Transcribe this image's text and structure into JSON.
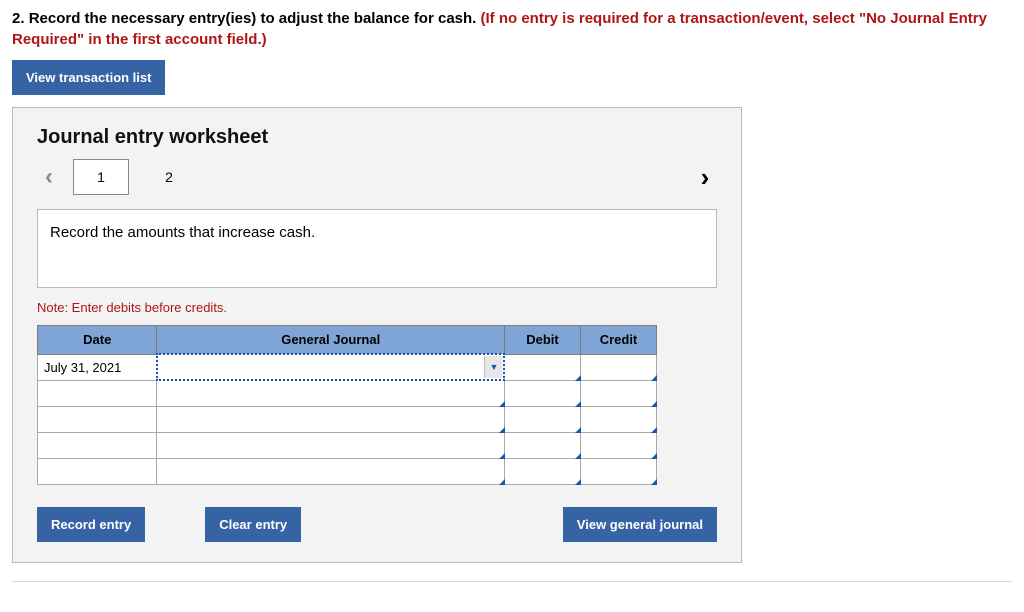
{
  "question": {
    "prefix": "2. ",
    "text": "Record the necessary entry(ies) to adjust the balance for cash. ",
    "red": "(If no entry is required for a transaction/event, select \"No Journal Entry Required\" in the first account field.)"
  },
  "buttons": {
    "view_transaction_list": "View transaction list",
    "record_entry": "Record entry",
    "clear_entry": "Clear entry",
    "view_general_journal": "View general journal"
  },
  "worksheet": {
    "title": "Journal entry worksheet",
    "tabs": [
      "1",
      "2"
    ],
    "active_tab": 0,
    "instruction": "Record the amounts that increase cash.",
    "note": "Note: Enter debits before credits.",
    "headers": {
      "date": "Date",
      "general_journal": "General Journal",
      "debit": "Debit",
      "credit": "Credit"
    },
    "rows": [
      {
        "date": "July 31, 2021",
        "gj": "",
        "debit": "",
        "credit": ""
      },
      {
        "date": "",
        "gj": "",
        "debit": "",
        "credit": ""
      },
      {
        "date": "",
        "gj": "",
        "debit": "",
        "credit": ""
      },
      {
        "date": "",
        "gj": "",
        "debit": "",
        "credit": ""
      },
      {
        "date": "",
        "gj": "",
        "debit": "",
        "credit": ""
      }
    ]
  }
}
